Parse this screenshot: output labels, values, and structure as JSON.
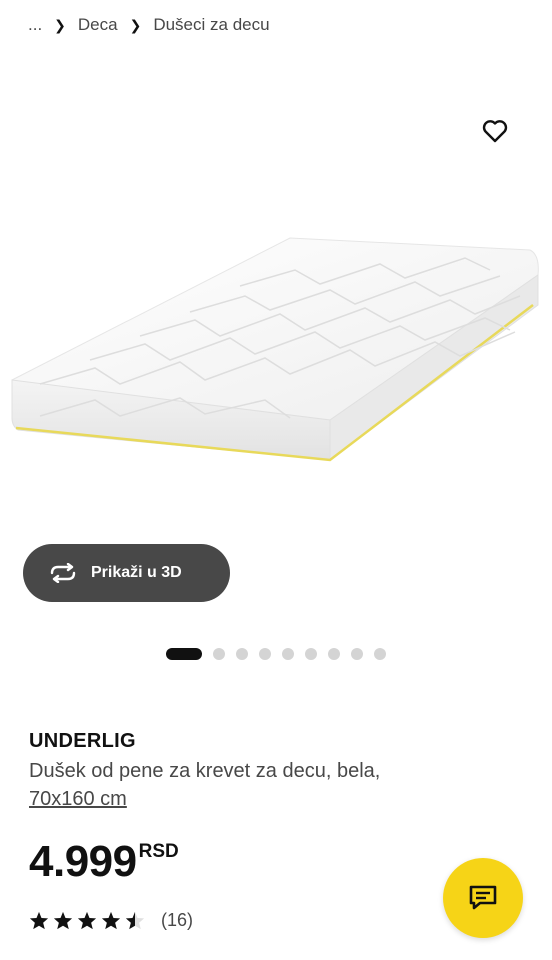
{
  "breadcrumb": {
    "ellipsis": "...",
    "items": [
      "Deca",
      "Dušeci za decu"
    ]
  },
  "product": {
    "name": "UNDERLIG",
    "description": "Dušek od pene za krevet za decu, bela,",
    "size": "70x160 cm",
    "price": "4.999",
    "currency": "RSD",
    "rating_count": "(16)",
    "rating": 4.5
  },
  "view3d": {
    "label": "Prikaži u 3D"
  },
  "carousel": {
    "total": 10,
    "active": 0
  },
  "icons": {
    "favorite": "heart-icon",
    "rotate": "rotate-3d-icon",
    "chat": "chat-icon"
  },
  "colors": {
    "accent": "#f6d417",
    "dark_button": "#484848"
  }
}
